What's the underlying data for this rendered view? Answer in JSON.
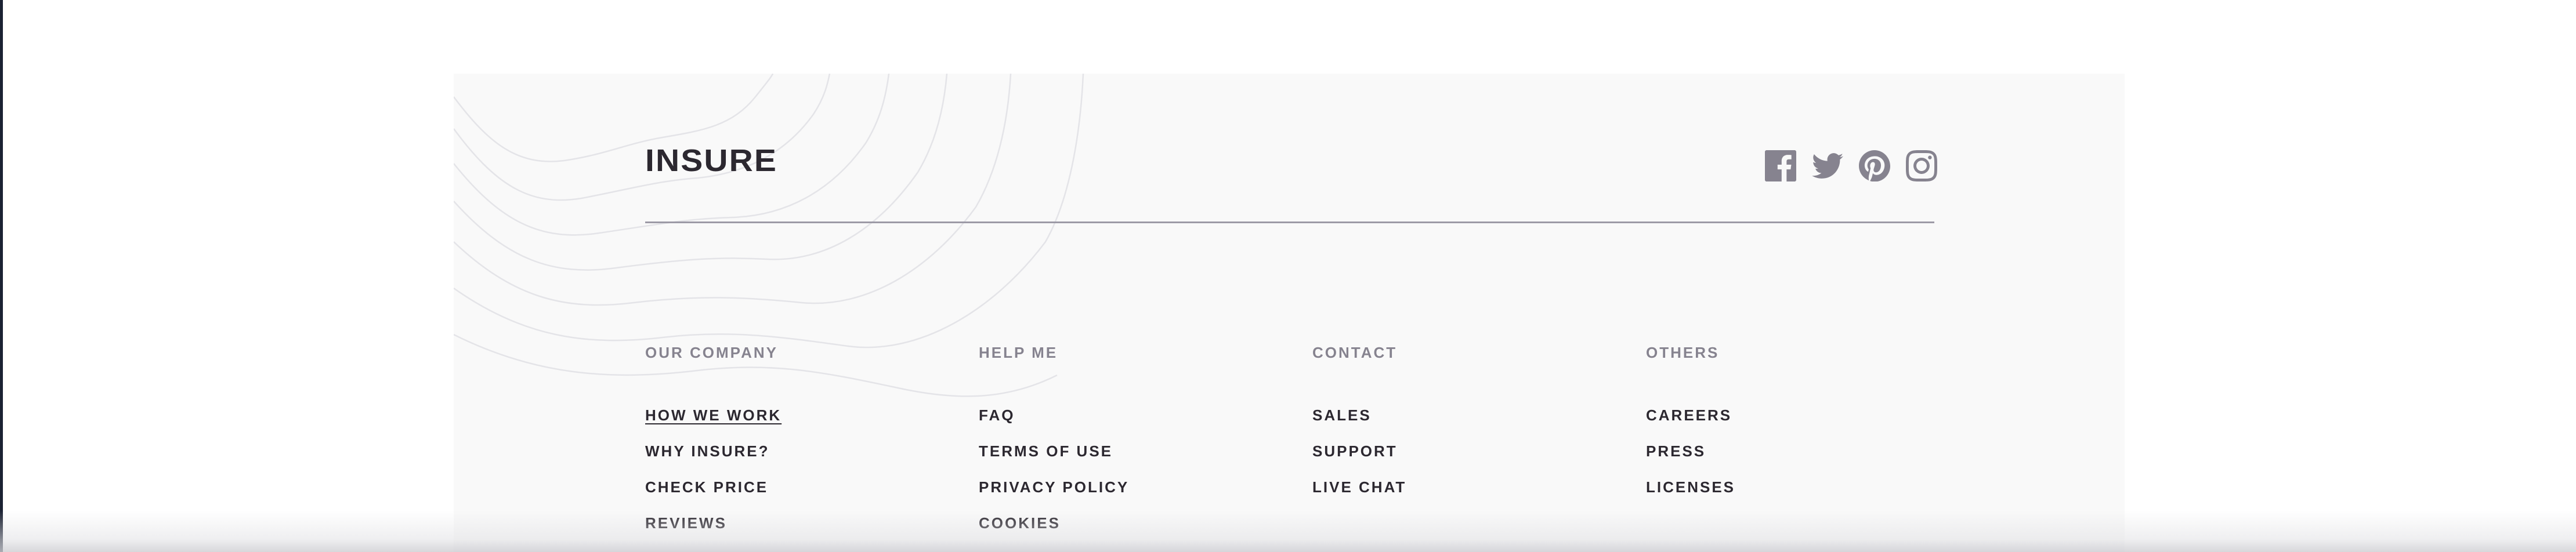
{
  "brand": {
    "logo_text": "INSURE"
  },
  "social": [
    {
      "name": "facebook-icon"
    },
    {
      "name": "twitter-icon"
    },
    {
      "name": "pinterest-icon"
    },
    {
      "name": "instagram-icon"
    }
  ],
  "columns": [
    {
      "title": "OUR COMPANY",
      "links": [
        "HOW WE WORK",
        "WHY INSURE?",
        "CHECK PRICE",
        "REVIEWS"
      ]
    },
    {
      "title": "HELP ME",
      "links": [
        "FAQ",
        "TERMS OF USE",
        "PRIVACY POLICY",
        "COOKIES"
      ]
    },
    {
      "title": "CONTACT",
      "links": [
        "SALES",
        "SUPPORT",
        "LIVE CHAT"
      ]
    },
    {
      "title": "OTHERS",
      "links": [
        "CAREERS",
        "PRESS",
        "LICENSES"
      ]
    }
  ],
  "colors": {
    "footer_bg": "#f9f9f9",
    "heading_gray": "#86838f",
    "link_dark": "#2c2830",
    "icon_gray": "#86838f",
    "divider": "#9c9aa6"
  }
}
